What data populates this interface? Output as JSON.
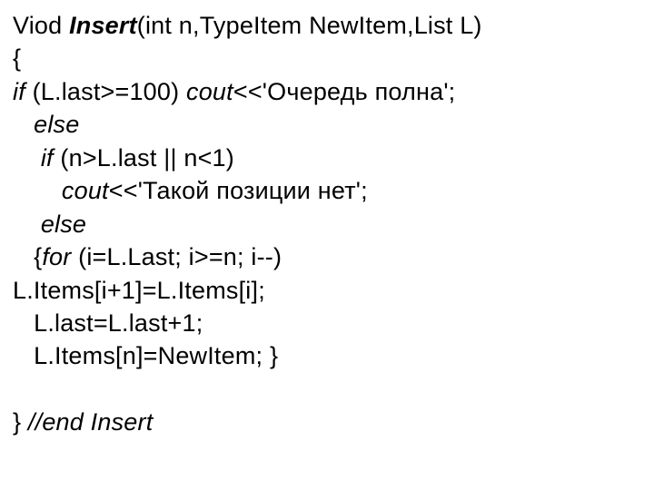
{
  "code": {
    "l1_a": "Viod ",
    "l1_b": "Insert",
    "l1_c": "(int n,TypeItem NewItem,List L)",
    "l2": "{",
    "l3_a": "if",
    "l3_b": " (L.last>=100)",
    "l3_c": " cout",
    "l3_d": "<<'Очередь полна';",
    "l4_a": "   ",
    "l4_b": "else",
    "l5_a": "    ",
    "l5_b": "if ",
    "l5_c": "(n>L.last || n<1)",
    "l6_a": "       ",
    "l6_b": "cout",
    "l6_c": "<<'Такой позиции нет';",
    "l7_a": "    ",
    "l7_b": "else",
    "l8_a": "   {",
    "l8_b": "for",
    "l8_c": " (i=L.Last; i>=n; i--)",
    "l9": "L.Items[i+1]=L.Items[i];",
    "l10": "   L.last=L.last+1;",
    "l11": "   L.Items[n]=NewItem; }",
    "l12": " ",
    "l13_a": "} ",
    "l13_b": "//end Insert"
  }
}
